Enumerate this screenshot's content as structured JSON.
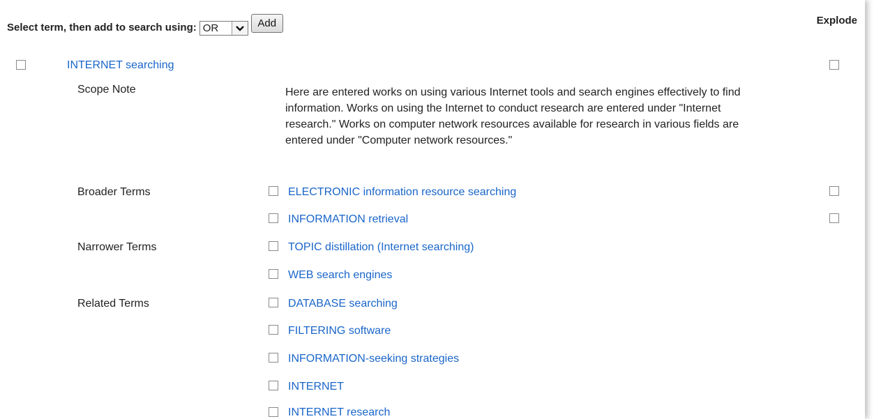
{
  "toolbar": {
    "label": "Select term, then add to search using:",
    "select_value": "OR",
    "add_label": "Add"
  },
  "explode_header": "Explode",
  "main_term": "INTERNET searching",
  "scope_note": {
    "label": "Scope Note",
    "text": "Here are entered works on using various Internet tools and search engines effectively to find information. Works on using the Internet to conduct research are entered under \"Internet research.\" Works on computer network resources available for research in various fields are entered under \"Computer network resources.\""
  },
  "broader": {
    "label": "Broader Terms",
    "items": [
      "ELECTRONIC information resource searching",
      "INFORMATION retrieval"
    ]
  },
  "narrower": {
    "label": "Narrower Terms",
    "items": [
      "TOPIC distillation (Internet searching)",
      "WEB search engines"
    ]
  },
  "related": {
    "label": "Related Terms",
    "items": [
      "DATABASE searching",
      "FILTERING software",
      "INFORMATION-seeking strategies",
      "INTERNET",
      "INTERNET research"
    ]
  }
}
